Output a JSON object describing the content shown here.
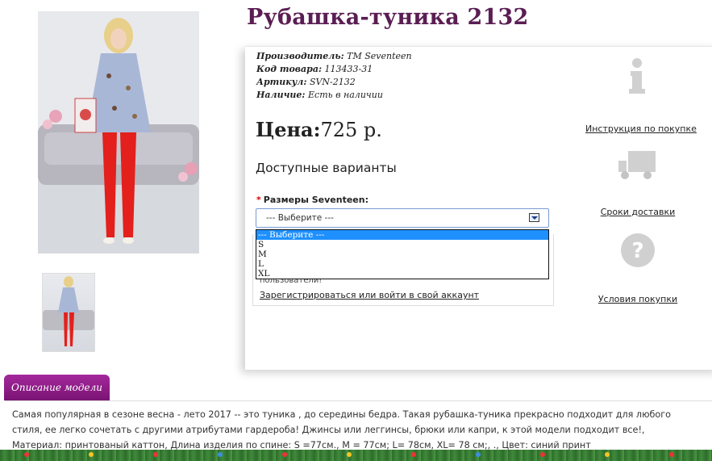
{
  "product": {
    "title": "Рубашка-туника 2132",
    "meta": [
      {
        "label": "Производитель:",
        "value": "TM Seventeen"
      },
      {
        "label": "Код товара:",
        "value": "113433-31"
      },
      {
        "label": "Артикул:",
        "value": "SVN-2132"
      },
      {
        "label": "Наличие:",
        "value": "Есть в наличии"
      }
    ],
    "price_label": "Цена:",
    "price_value": "725 р.",
    "variants_heading": "Доступные варианты",
    "size_label": "Размеры Seventeen:",
    "size_required_mark": "*",
    "size_select_value": "--- Выберите ---",
    "size_options": [
      "--- Выберите ---",
      "S",
      "M",
      "L",
      "XL"
    ],
    "login_text": "пользователи!",
    "login_link": "Зарегистрироваться или войти в свой аккаунт"
  },
  "sidebar": {
    "items": [
      {
        "icon": "info-icon",
        "label": "Инструкция по покупке"
      },
      {
        "icon": "truck-icon",
        "label": "Сроки доставки"
      },
      {
        "icon": "question-icon",
        "label": "Условия покупки"
      }
    ]
  },
  "description": {
    "tab_label": "Описание модели",
    "text": "Самая популярная в сезоне весна - лето 2017 -- это туника , до середины бедра. Такая рубашка-туника прекрасно подходит для любого стиля, ее легко сочетать с другими атрибутами гардероба! Джинсы или леггинсы, брюки или капри, к этой модели подходит все!, Материал: принтованый каттон, Длина изделия по спине: S =77см., M = 77см; L= 78см, XL= 78 см;, ., Цвет: синий принт"
  },
  "colors": {
    "title": "#5a1e53",
    "tab": "#8e1f88",
    "select_highlight": "#1e90ff",
    "pants": "#e3201c",
    "top": "#a9b7d6"
  }
}
